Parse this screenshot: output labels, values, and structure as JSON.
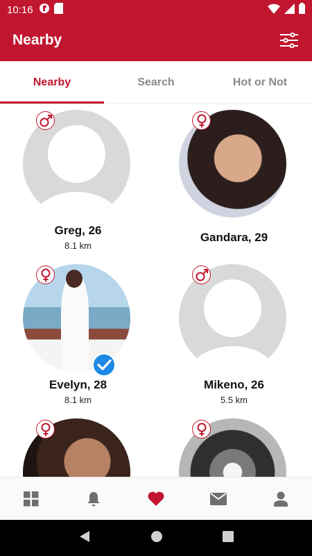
{
  "status_bar": {
    "time": "10:16"
  },
  "app_bar": {
    "title": "Nearby"
  },
  "tabs": [
    {
      "label": "Nearby",
      "active": true
    },
    {
      "label": "Search",
      "active": false
    },
    {
      "label": "Hot or Not",
      "active": false
    }
  ],
  "profiles": [
    {
      "name": "Greg, 26",
      "distance": "8.1 km",
      "gender": "male-icon",
      "photo": "placeholder"
    },
    {
      "name": "Gandara, 29",
      "distance": "",
      "gender": "female-icon",
      "photo": "photo"
    },
    {
      "name": "Evelyn, 28",
      "distance": "8.1 km",
      "gender": "female-icon",
      "photo": "photo",
      "verified": true
    },
    {
      "name": "Mikeno, 26",
      "distance": "5.5 km",
      "gender": "male-icon",
      "photo": "placeholder"
    },
    {
      "name": "",
      "distance": "",
      "gender": "female-icon",
      "photo": "photo"
    },
    {
      "name": "",
      "distance": "",
      "gender": "female-icon",
      "photo": "photo"
    }
  ],
  "bottom_nav": [
    "grid-icon",
    "bell-icon",
    "heart-icon",
    "mail-icon",
    "person-icon"
  ],
  "colors": {
    "accent": "#c1162f",
    "verified": "#1e88e5",
    "placeholder": "#d9d9d9"
  }
}
